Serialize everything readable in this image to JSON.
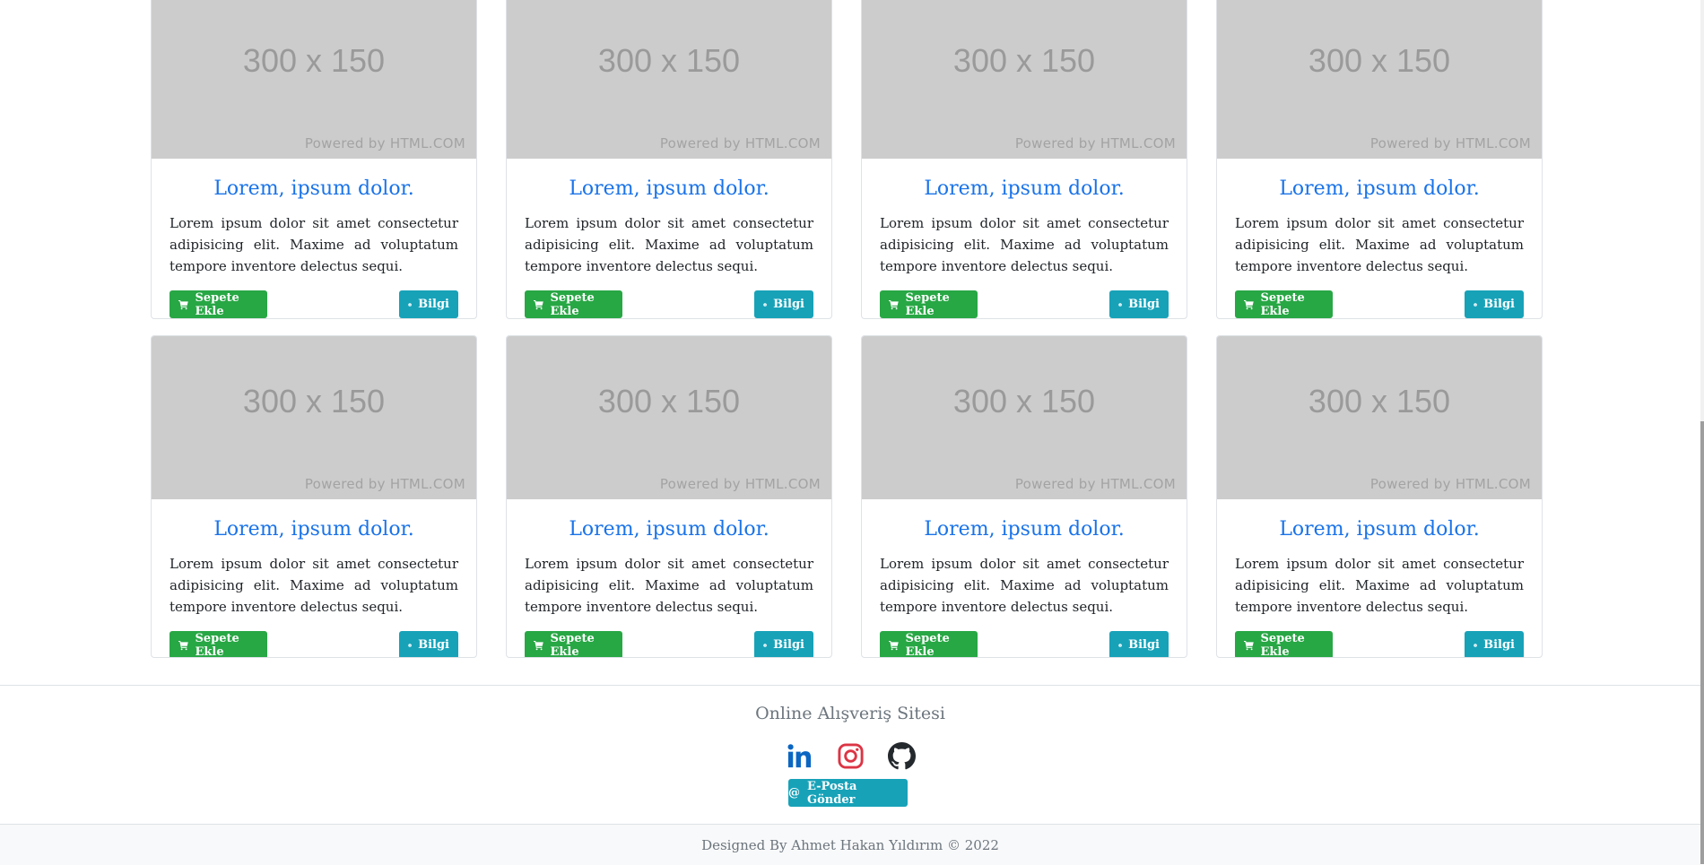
{
  "products": [
    {
      "image_size_label": "300 x 150",
      "image_credit": "Powered by HTML.COM",
      "title": "Lorem, ipsum dolor.",
      "description": "Lorem ipsum dolor sit amet consectetur adipisicing elit. Maxime ad voluptatum tempore inventore delectus sequi.",
      "add_to_cart_label": "Sepete Ekle",
      "info_label": "Bilgi"
    },
    {
      "image_size_label": "300 x 150",
      "image_credit": "Powered by HTML.COM",
      "title": "Lorem, ipsum dolor.",
      "description": "Lorem ipsum dolor sit amet consectetur adipisicing elit. Maxime ad voluptatum tempore inventore delectus sequi.",
      "add_to_cart_label": "Sepete Ekle",
      "info_label": "Bilgi"
    },
    {
      "image_size_label": "300 x 150",
      "image_credit": "Powered by HTML.COM",
      "title": "Lorem, ipsum dolor.",
      "description": "Lorem ipsum dolor sit amet consectetur adipisicing elit. Maxime ad voluptatum tempore inventore delectus sequi.",
      "add_to_cart_label": "Sepete Ekle",
      "info_label": "Bilgi"
    },
    {
      "image_size_label": "300 x 150",
      "image_credit": "Powered by HTML.COM",
      "title": "Lorem, ipsum dolor.",
      "description": "Lorem ipsum dolor sit amet consectetur adipisicing elit. Maxime ad voluptatum tempore inventore delectus sequi.",
      "add_to_cart_label": "Sepete Ekle",
      "info_label": "Bilgi"
    },
    {
      "image_size_label": "300 x 150",
      "image_credit": "Powered by HTML.COM",
      "title": "Lorem, ipsum dolor.",
      "description": "Lorem ipsum dolor sit amet consectetur adipisicing elit. Maxime ad voluptatum tempore inventore delectus sequi.",
      "add_to_cart_label": "Sepete Ekle",
      "info_label": "Bilgi"
    },
    {
      "image_size_label": "300 x 150",
      "image_credit": "Powered by HTML.COM",
      "title": "Lorem, ipsum dolor.",
      "description": "Lorem ipsum dolor sit amet consectetur adipisicing elit. Maxime ad voluptatum tempore inventore delectus sequi.",
      "add_to_cart_label": "Sepete Ekle",
      "info_label": "Bilgi"
    },
    {
      "image_size_label": "300 x 150",
      "image_credit": "Powered by HTML.COM",
      "title": "Lorem, ipsum dolor.",
      "description": "Lorem ipsum dolor sit amet consectetur adipisicing elit. Maxime ad voluptatum tempore inventore delectus sequi.",
      "add_to_cart_label": "Sepete Ekle",
      "info_label": "Bilgi"
    },
    {
      "image_size_label": "300 x 150",
      "image_credit": "Powered by HTML.COM",
      "title": "Lorem, ipsum dolor.",
      "description": "Lorem ipsum dolor sit amet consectetur adipisicing elit. Maxime ad voluptatum tempore inventore delectus sequi.",
      "add_to_cart_label": "Sepete Ekle",
      "info_label": "Bilgi"
    }
  ],
  "footer": {
    "title": "Online Alışveriş Sitesi",
    "socials": [
      {
        "name": "linkedin-icon",
        "color": "#0a66c2"
      },
      {
        "name": "instagram-icon",
        "color": "#dc3545"
      },
      {
        "name": "github-icon",
        "color": "#24292e"
      }
    ],
    "email_button_label": "E-Posta Gönder",
    "copyright": "Designed By Ahmet Hakan Yıldırım © 2022"
  },
  "colors": {
    "title_blue": "#1a73e8",
    "button_green": "#28a745",
    "button_info": "#17a2b8",
    "placeholder_gray": "#cccccc"
  }
}
